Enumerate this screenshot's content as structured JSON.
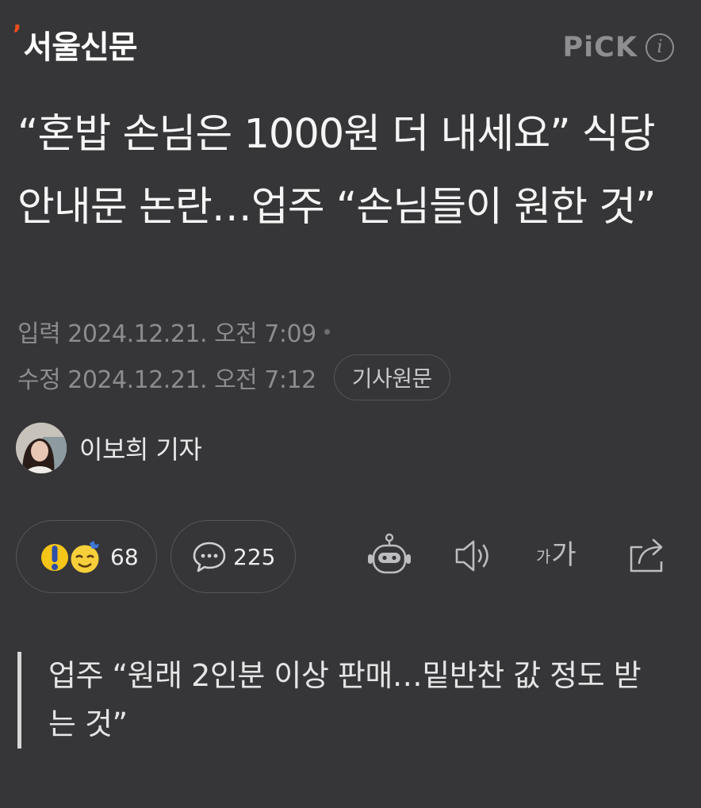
{
  "header": {
    "logo_mark": "’",
    "logo_text": "서울신문",
    "pick_label": "PiCK",
    "info_icon": "i"
  },
  "article": {
    "headline": "“혼밥 손님은 1000원 더 내세요” 식당 안내문 논란…업주 “손님들이 원한 것”",
    "input_date": "입력 2024.12.21. 오전 7:09",
    "modified_date": "수정 2024.12.21. 오전 7:12",
    "source_button": "기사원문",
    "reporter": "이보희 기자",
    "subheadline": "업주 “원래 2인분 이상 판매…밑반찬 값 정도 받는 것”"
  },
  "actions": {
    "reaction_count": "68",
    "comment_count": "225",
    "font_size_label_small": "가",
    "font_size_label_large": "가"
  },
  "icons": [
    "exclamation-emoji-icon",
    "smile-emoji-icon",
    "comment-bubble-icon",
    "ai-bot-icon",
    "speaker-icon",
    "font-size-icon",
    "share-icon",
    "info-icon"
  ],
  "colors": {
    "background": "#363638",
    "brand_mark": "#ff4d1c",
    "muted_text": "#8c8c8e",
    "headline_text": "#f5f5f5"
  }
}
